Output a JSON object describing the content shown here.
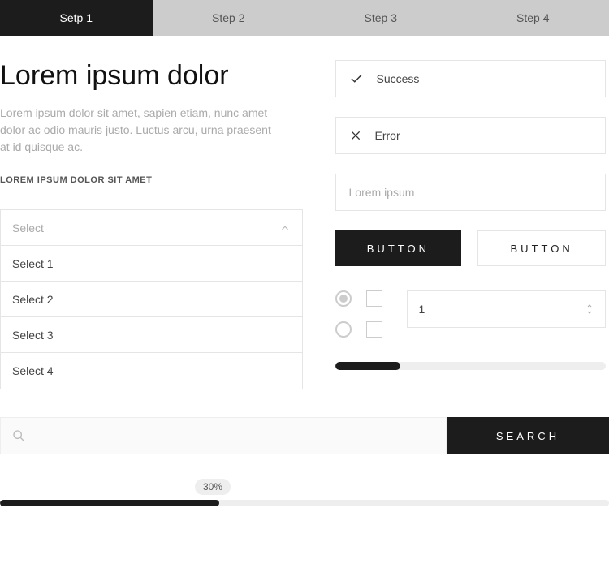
{
  "steps": {
    "items": [
      {
        "label": "Setp 1"
      },
      {
        "label": "Step 2"
      },
      {
        "label": "Step 3"
      },
      {
        "label": "Step 4"
      }
    ]
  },
  "left": {
    "heading": "Lorem ipsum dolor",
    "description": "Lorem ipsum dolor sit amet, sapien etiam, nunc amet dolor ac odio mauris justo. Luctus arcu, urna praesent at id quisque ac.",
    "subheading": "LOREM IPSUM DOLOR SIT AMET",
    "dropdown": {
      "placeholder": "Select",
      "options": [
        {
          "label": "Select 1"
        },
        {
          "label": "Select 2"
        },
        {
          "label": "Select 3"
        },
        {
          "label": "Select 4"
        }
      ]
    }
  },
  "right": {
    "alerts": {
      "success_label": "Success",
      "error_label": "Error"
    },
    "input": {
      "placeholder": "Lorem ipsum"
    },
    "buttons": {
      "primary_label": "BUTTON",
      "secondary_label": "BUTTON"
    },
    "stepper": {
      "value": "1"
    },
    "slider": {
      "percent": 24
    }
  },
  "search": {
    "button_label": "SEARCH"
  },
  "progress": {
    "label": "30%",
    "percent": 36
  }
}
